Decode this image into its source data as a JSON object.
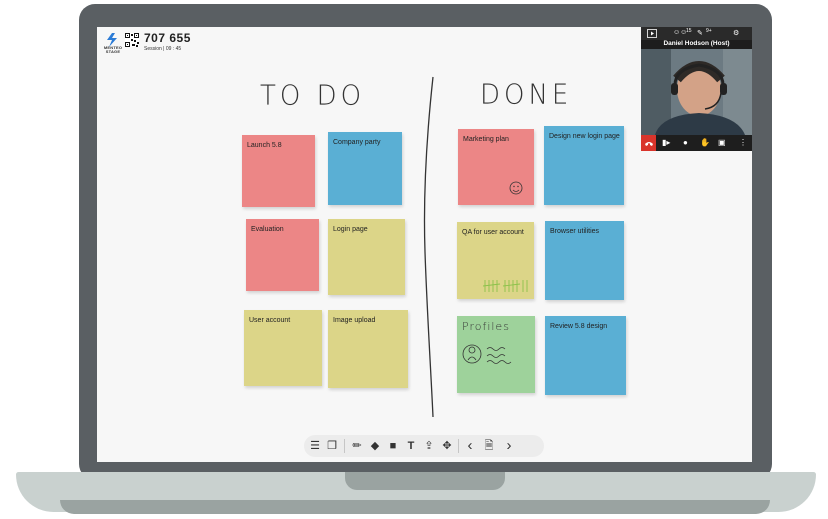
{
  "session": {
    "brand": "MENTEO STAGE",
    "code": "707 655",
    "info": "Session | 09 : 45"
  },
  "board": {
    "todo_heading": "TO DO",
    "done_heading": "DONE",
    "notes": [
      {
        "label": "Launch 5.8"
      },
      {
        "label": "Company party"
      },
      {
        "label": "Evaluation"
      },
      {
        "label": "Login page"
      },
      {
        "label": "User account"
      },
      {
        "label": "Image upload"
      },
      {
        "label": "Marketing plan"
      },
      {
        "label": "Design new login page"
      },
      {
        "label": "QA for user account"
      },
      {
        "label": "Browser utilities"
      },
      {
        "label": "Review 5.8 design"
      }
    ],
    "sketch_text": "Profiles"
  },
  "video": {
    "host_name": "Daniel Hodson (Host)",
    "participants_count": "15",
    "chat_count": "9+"
  },
  "colors": {
    "red": "#ec8686",
    "blue": "#5aafd4",
    "yellow": "#dcd588",
    "green": "#9ed29b",
    "hangup": "#d9342b"
  },
  "toolbar": {
    "menu": "☰",
    "text_tool": "T",
    "prev": "‹",
    "next": "›"
  }
}
